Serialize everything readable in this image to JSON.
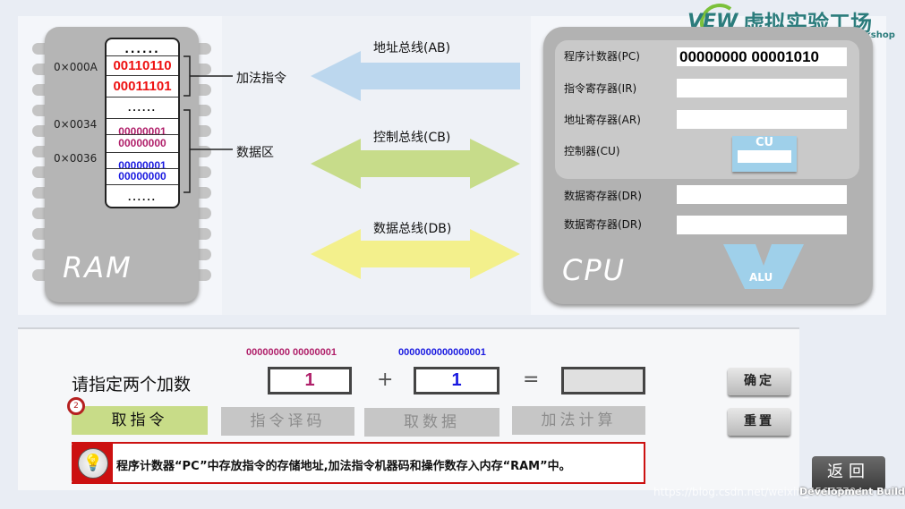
{
  "logo": {
    "brand": "VEW",
    "title": "虚拟实验工场",
    "subtitle": "Virtual Experiment Workshop"
  },
  "ram": {
    "label": "RAM",
    "dots": "......",
    "addresses": [
      "0×000A",
      "0×0034",
      "0×0036"
    ],
    "instruction_bytes": [
      "00110110",
      "00011101"
    ],
    "data_bytes_a": [
      "00000001",
      "00000000"
    ],
    "data_bytes_b": [
      "00000001",
      "00000000"
    ],
    "annotations": {
      "instruction": "加法指令",
      "data": "数据区"
    }
  },
  "buses": [
    {
      "label": "地址总线(AB)",
      "color": "#bcd7ee"
    },
    {
      "label": "控制总线(CB)",
      "color": "#c7dc8a"
    },
    {
      "label": "数据总线(DB)",
      "color": "#f3f08c"
    }
  ],
  "cpu": {
    "label": "CPU",
    "registers": [
      {
        "label": "程序计数器(PC)",
        "value": "00000000 00001010"
      },
      {
        "label": "指令寄存器(IR)",
        "value": ""
      },
      {
        "label": "地址寄存器(AR)",
        "value": ""
      },
      {
        "label": "控制器(CU)",
        "unit": "CU"
      },
      {
        "label": "数据寄存器(DR)",
        "value": ""
      },
      {
        "label": "数据寄存器(DR)",
        "value": ""
      }
    ],
    "alu": "ALU"
  },
  "controls": {
    "prompt": "请指定两个加数",
    "binary_a": "00000000 00000001",
    "binary_b": "0000000000000001",
    "operand_a": "1",
    "operand_b": "1",
    "plus": "+",
    "equals": "=",
    "result": "",
    "confirm": "确定",
    "reset": "重置",
    "step_badge": "2",
    "steps": [
      {
        "label": "取指令",
        "active": true
      },
      {
        "label": "指令译码",
        "active": false
      },
      {
        "label": "取数据",
        "active": false
      },
      {
        "label": "加法计算",
        "active": false
      }
    ],
    "hint": "程序计数器“PC”中存放指令的存储地址,加法指令机器码和操作数存入内存“RAM”中。"
  },
  "back": "返回",
  "watermark": "https://blog.csdn.net/weixin_45677704",
  "build_label": "Development Build",
  "colors": {
    "instr": "#ee1111",
    "data_a": "#b0206a",
    "data_b": "#1a1ae0",
    "active_step": "#c8dc88",
    "hint_border": "#cc1111"
  }
}
